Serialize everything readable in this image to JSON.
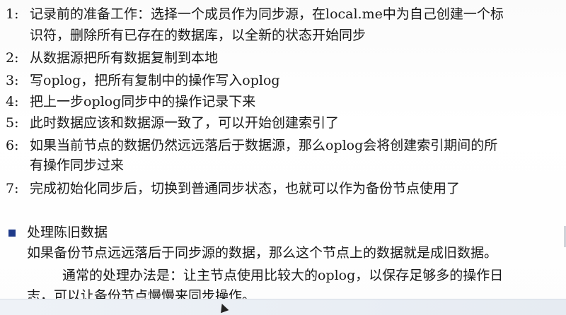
{
  "items": [
    {
      "num": "1:",
      "lines": [
        "记录前的准备工作：选择一个成员作为同步源，在local.me中为自己创建一个标",
        "识符，删除所有已存在的数据库，以全新的状态开始同步"
      ]
    },
    {
      "num": "2:",
      "lines": [
        "从数据源把所有数据复制到本地"
      ]
    },
    {
      "num": "3:",
      "lines": [
        "写oplog，把所有复制中的操作写入oplog"
      ]
    },
    {
      "num": "4:",
      "lines": [
        "把上一步oplog同步中的操作记录下来"
      ]
    },
    {
      "num": "5:",
      "lines": [
        "此时数据应该和数据源一致了，可以开始创建索引了"
      ]
    },
    {
      "num": "6:",
      "lines": [
        "如果当前节点的数据仍然远远落后于数据源，那么oplog会将创建索引期间的所",
        "有操作同步过来"
      ]
    },
    {
      "num": "7:",
      "lines": [
        "完成初始化同步后，切换到普通同步状态，也就可以作为备份节点使用了"
      ]
    }
  ],
  "section": {
    "heading": "处理陈旧数据",
    "para1": "如果备份节点远远落后于同步源的数据，那么这个节点上的数据就是成旧数据。",
    "para2_line1": "通常的处理办法是：让主节点使用比较大的oplog，以保存足够多的操作日",
    "para2_line2": "志，可以让备份节点慢慢来同步操作。"
  }
}
